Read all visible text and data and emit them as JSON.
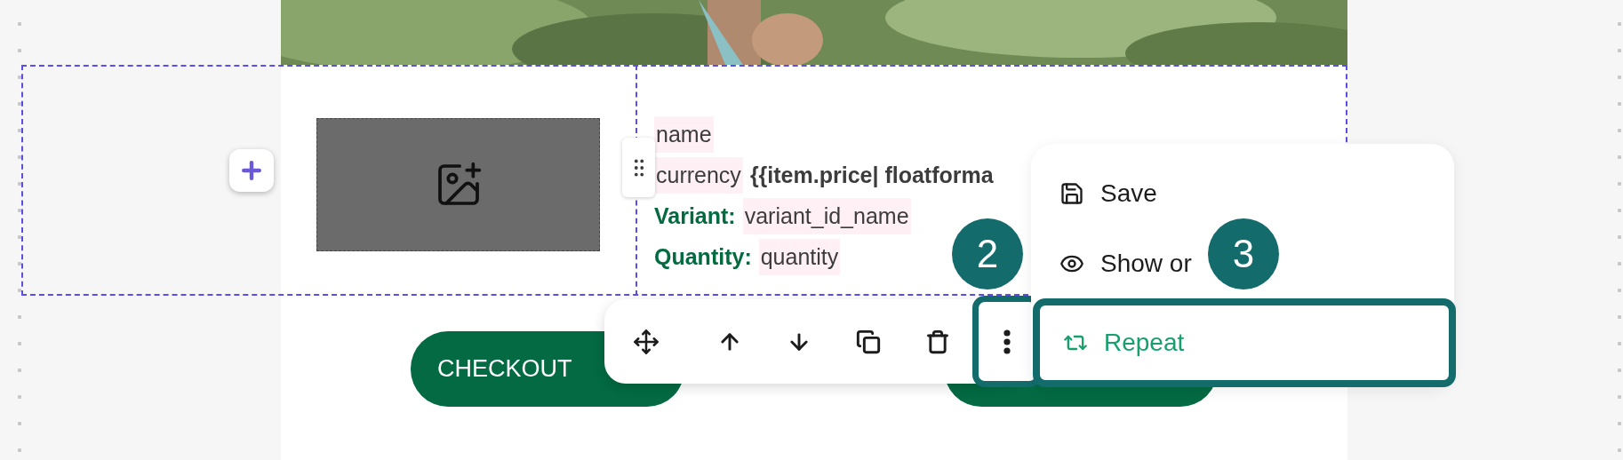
{
  "photo": {
    "kind": "picture"
  },
  "product": {
    "lines": [
      {
        "value": "name"
      },
      {
        "value": "currency",
        "suffix": "{{item.price| floatforma"
      },
      {
        "label": "Variant:",
        "value": "variant_id_name"
      },
      {
        "label": "Quantity:",
        "value": "quantity"
      }
    ]
  },
  "buttons": [
    {
      "kind": "labeled",
      "label": "CHECKOUT"
    },
    {
      "kind": "covered"
    }
  ],
  "toolbar": {
    "actions": [
      {
        "kind": "move"
      },
      {
        "kind": "up"
      },
      {
        "kind": "down"
      },
      {
        "kind": "copy"
      },
      {
        "kind": "delete"
      },
      {
        "kind": "more",
        "selected": true
      }
    ]
  },
  "menu": {
    "items": [
      {
        "kind": "save",
        "label": "Save",
        "selected": false
      },
      {
        "kind": "eye",
        "label": "Show or",
        "selected": false
      },
      {
        "kind": "repeat",
        "label": "Repeat",
        "selected": true
      }
    ]
  },
  "badges": [
    "2",
    "3"
  ]
}
